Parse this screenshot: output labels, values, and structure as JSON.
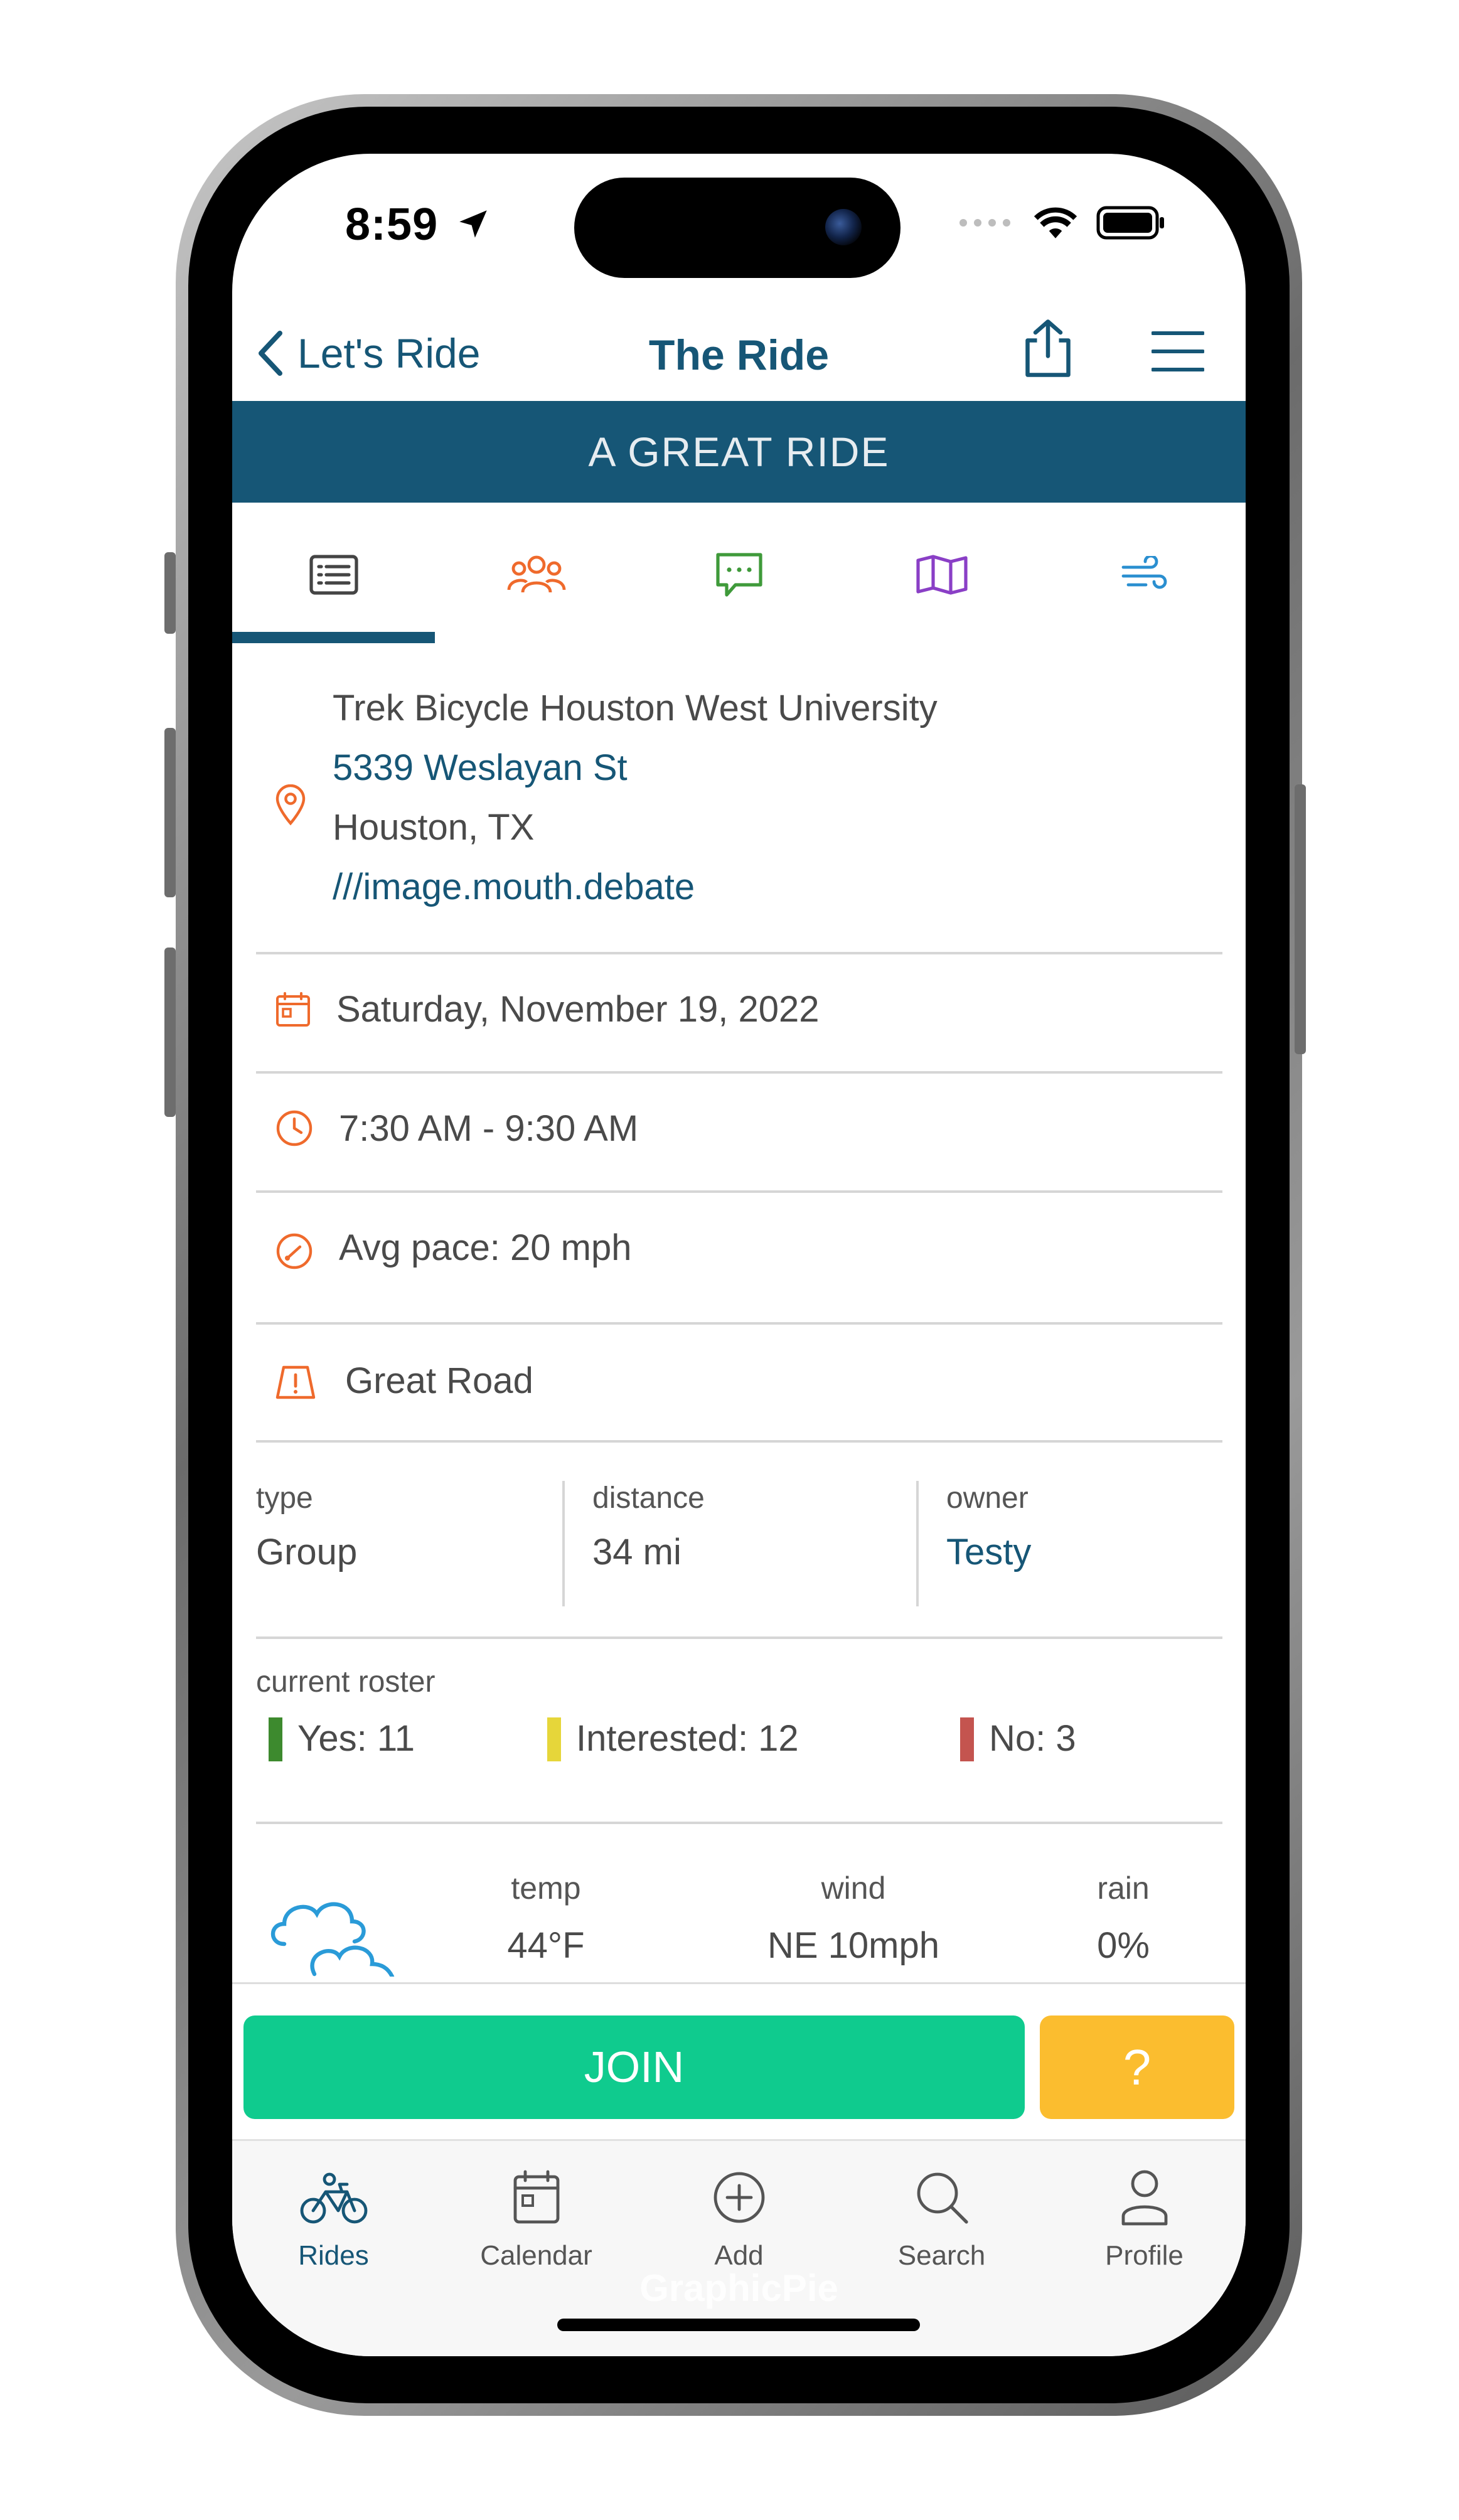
{
  "status": {
    "time": "8:59"
  },
  "nav": {
    "back_label": "Let's Ride",
    "title": "The Ride"
  },
  "banner": "A GREAT RIDE",
  "tabs": [
    "details-icon",
    "riders-icon",
    "chat-icon",
    "map-icon",
    "wind-icon"
  ],
  "location": {
    "name": "Trek Bicycle Houston West University",
    "street": "5339 Weslayan St",
    "city": "Houston, TX",
    "w3w": "///image.mouth.debate"
  },
  "date": "Saturday, November 19, 2022",
  "time_range": "7:30 AM - 9:30 AM",
  "pace": "Avg pace: 20 mph",
  "road": "Great Road",
  "info": {
    "type_label": "type",
    "type_value": "Group",
    "distance_label": "distance",
    "distance_value": "34 mi",
    "owner_label": "owner",
    "owner_value": "Testy"
  },
  "roster": {
    "label": "current roster",
    "yes": "Yes: 11",
    "interested": "Interested: 12",
    "no": "No: 3"
  },
  "weather": {
    "temp_label": "temp",
    "temp_value": "44°F",
    "wind_label": "wind",
    "wind_value": "NE 10mph",
    "rain_label": "rain",
    "rain_value": "0%"
  },
  "actions": {
    "join": "JOIN",
    "help": "?"
  },
  "tabbar": {
    "rides": "Rides",
    "calendar": "Calendar",
    "add": "Add",
    "search": "Search",
    "profile": "Profile"
  },
  "watermark": "GraphicPie",
  "colors": {
    "primary": "#165676",
    "accent_orange": "#ef6a2c",
    "join_green": "#0fcb8e",
    "help_yellow": "#fbbd2f",
    "yes_green": "#3d8a2e",
    "interested_yellow": "#e6d63a",
    "no_red": "#c4544f"
  }
}
